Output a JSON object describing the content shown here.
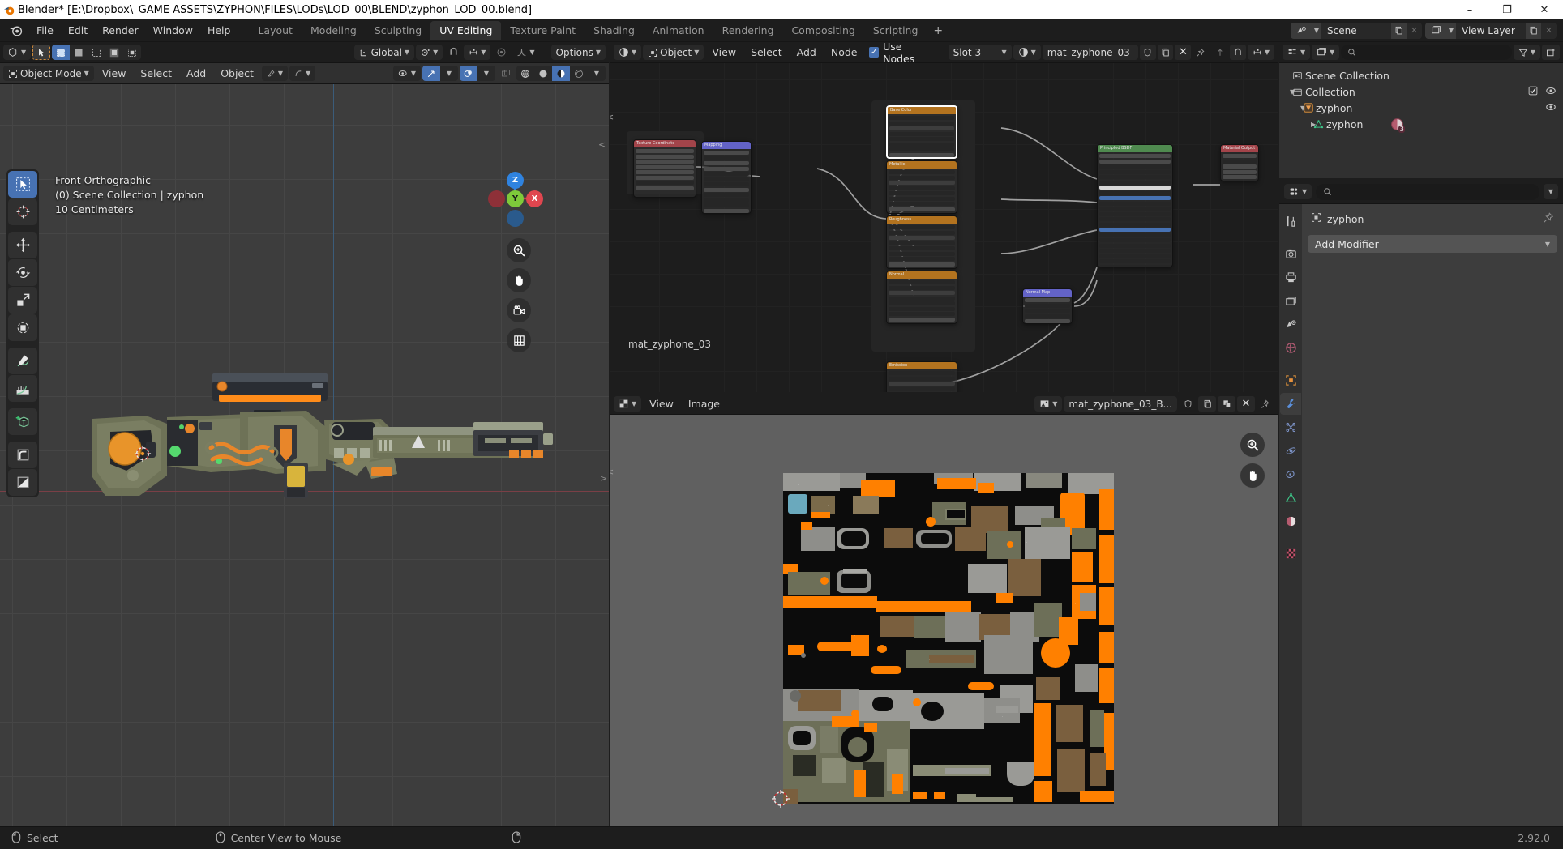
{
  "window": {
    "title": "Blender* [E:\\Dropbox\\_GAME ASSETS\\ZYPHON\\FILES\\LODs\\LOD_00\\BLEND\\zyphon_LOD_00.blend]",
    "minimize": "–",
    "maximize": "❐",
    "close": "✕"
  },
  "topbar": {
    "menus": [
      "File",
      "Edit",
      "Render",
      "Window",
      "Help"
    ],
    "workspaces": [
      {
        "label": "Layout",
        "active": false
      },
      {
        "label": "Modeling",
        "active": false
      },
      {
        "label": "Sculpting",
        "active": false
      },
      {
        "label": "UV Editing",
        "active": true
      },
      {
        "label": "Texture Paint",
        "active": false
      },
      {
        "label": "Shading",
        "active": false
      },
      {
        "label": "Animation",
        "active": false
      },
      {
        "label": "Rendering",
        "active": false
      },
      {
        "label": "Compositing",
        "active": false
      },
      {
        "label": "Scripting",
        "active": false
      }
    ],
    "add_workspace": "+",
    "scene": {
      "label": "Scene",
      "new_icon": "new-scene-icon",
      "delete_icon": "x-icon"
    },
    "view_layer": {
      "label": "View Layer",
      "new_icon": "new-layer-icon",
      "delete_icon": "x-icon"
    }
  },
  "viewport": {
    "header": {
      "editor_type": "editor-type-3dview",
      "mode": "Object Mode",
      "menus": [
        "View",
        "Select",
        "Add",
        "Object"
      ],
      "transform_orientation": "Global",
      "options": "Options"
    },
    "overlay": {
      "view_name": "Front Orthographic",
      "collection_line": "(0) Scene Collection | zyphon",
      "grid_scale": "10 Centimeters"
    },
    "gizmo": {
      "z": "Z",
      "y": "Y",
      "x": "X"
    },
    "tools": [
      {
        "name": "tweak-select-tool",
        "active": true
      },
      {
        "name": "cursor-tool",
        "active": false
      },
      {
        "name": "move-tool",
        "active": false
      },
      {
        "name": "rotate-tool",
        "active": false
      },
      {
        "name": "scale-tool",
        "active": false
      },
      {
        "name": "transform-tool",
        "active": false
      },
      {
        "name": "annotate-tool",
        "active": false
      },
      {
        "name": "measure-tool",
        "active": false
      },
      {
        "name": "add-cube-tool",
        "active": false
      },
      {
        "name": "bevel-tool",
        "active": false
      },
      {
        "name": "shear-tool",
        "active": false
      }
    ],
    "nav_buttons": [
      "zoom-icon",
      "pan-hand-icon",
      "camera-icon",
      "grid-ortho-icon"
    ]
  },
  "shader_editor": {
    "header": {
      "editor_type": "editor-type-shader",
      "shader_type": "Object",
      "menus": [
        "View",
        "Select",
        "Add",
        "Node"
      ],
      "use_nodes_label": "Use Nodes",
      "use_nodes_checked": true,
      "slot": "Slot 3",
      "material": "mat_zyphone_03"
    },
    "frame_label": "mat_zyphone_03",
    "nodes": [
      {
        "name": "Texture Coordinate",
        "type": "input",
        "color": "#a3444a"
      },
      {
        "name": "Mapping",
        "type": "vector",
        "color": "#6363c7"
      },
      {
        "name": "Base Color",
        "type": "texture",
        "color": "#b3731f"
      },
      {
        "name": "Metallic",
        "type": "texture",
        "color": "#b3731f"
      },
      {
        "name": "Roughness",
        "type": "texture",
        "color": "#b3731f"
      },
      {
        "name": "Normal",
        "type": "texture",
        "color": "#b3731f"
      },
      {
        "name": "Normal Map",
        "type": "vector",
        "color": "#6363c7"
      },
      {
        "name": "Emission",
        "type": "texture",
        "color": "#b3731f"
      },
      {
        "name": "Principled BSDF",
        "type": "shader",
        "color": "#4f8a4f"
      },
      {
        "name": "Material Output",
        "type": "output",
        "color": "#a3444a"
      }
    ]
  },
  "uv_editor": {
    "header": {
      "editor_type": "editor-type-uvimage",
      "menus": [
        "View",
        "Image"
      ],
      "image_name": "mat_zyphone_03_B...",
      "fake_user_icon": "shield-icon",
      "new_icon": "new-image-icon",
      "copy_icon": "copy-icon",
      "delete_icon": "x-icon",
      "pin_icon": "pin-icon"
    },
    "side_buttons": [
      "zoom-icon",
      "pan-hand-icon"
    ]
  },
  "outliner": {
    "header": {
      "display_mode": "view-layer-icon",
      "filter_icon": "filter-icon",
      "new_collection_icon": "new-collection-icon",
      "search_placeholder": ""
    },
    "rows": [
      {
        "label": "Scene Collection",
        "icon": "scene-collection-icon",
        "depth": 0,
        "expanded": null,
        "checkbox": false,
        "eye": false
      },
      {
        "label": "Collection",
        "icon": "collection-icon",
        "depth": 1,
        "expanded": true,
        "checkbox": true,
        "eye": true
      },
      {
        "label": "zyphon",
        "icon": "object-mesh-icon",
        "depth": 2,
        "expanded": true,
        "checkbox": false,
        "eye": true
      },
      {
        "label": "zyphon",
        "icon": "mesh-data-icon",
        "depth": 3,
        "expanded": false,
        "checkbox": false,
        "eye": false,
        "badge": "3"
      }
    ]
  },
  "properties": {
    "header": {
      "editor_icon": "properties-icon",
      "search_placeholder": ""
    },
    "breadcrumb_object": "zyphon",
    "pin_icon": "pin-icon",
    "add_modifier": "Add Modifier",
    "tabs": [
      {
        "name": "tool-tab",
        "active": false
      },
      {
        "name": "render-tab",
        "active": false
      },
      {
        "name": "output-tab",
        "active": false
      },
      {
        "name": "view-layer-tab",
        "active": false
      },
      {
        "name": "scene-tab",
        "active": false
      },
      {
        "name": "world-tab",
        "active": false
      },
      {
        "name": "object-tab",
        "active": false
      },
      {
        "name": "modifier-tab",
        "active": true
      },
      {
        "name": "particles-tab",
        "active": false
      },
      {
        "name": "physics-tab",
        "active": false
      },
      {
        "name": "constraints-tab",
        "active": false
      },
      {
        "name": "data-tab",
        "active": false
      },
      {
        "name": "material-tab",
        "active": false
      },
      {
        "name": "texture-tab",
        "active": false
      }
    ]
  },
  "statusbar": {
    "items": [
      {
        "icon": "mouse-left-icon",
        "label": "Select"
      },
      {
        "icon": "mouse-middle-icon",
        "label": "Center View to Mouse"
      },
      {
        "icon": "mouse-right-icon",
        "label": ""
      }
    ],
    "version": "2.92.0"
  },
  "colors": {
    "accent_blue": "#4772b3",
    "orange": "#ff8000",
    "header_bg": "#1d1d1d",
    "area_bg": "#303030",
    "viewport_bg": "#3d3d3d"
  }
}
